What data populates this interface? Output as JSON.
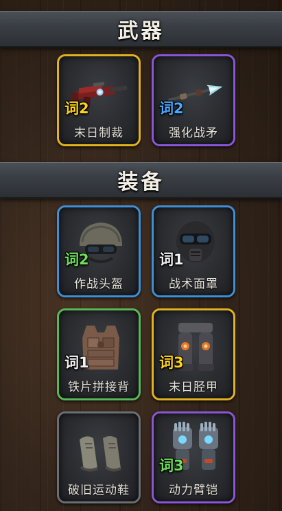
{
  "sections": [
    {
      "title": "武器"
    },
    {
      "title": "装备"
    }
  ],
  "colors": {
    "gold": "#e2b21f",
    "purple": "#8a56d8",
    "blue": "#3f8fd6",
    "green": "#58b857",
    "gray": "#6b6e72"
  },
  "weapons": [
    {
      "name": "末日制裁",
      "badge": "词2",
      "rarity": "gold",
      "icon": "plasma-rifle-icon"
    },
    {
      "name": "强化战矛",
      "badge": "词2",
      "rarity": "purple",
      "icon": "spear-icon"
    }
  ],
  "equipment": [
    {
      "name": "作战头盔",
      "badge": "词2",
      "rarity": "blue",
      "icon": "combat-helmet-icon"
    },
    {
      "name": "战术面罩",
      "badge": "词1",
      "rarity": "blue",
      "icon": "gas-mask-icon"
    },
    {
      "name": "铁片拼接背",
      "badge": "词1",
      "rarity": "green",
      "icon": "scrap-vest-icon"
    },
    {
      "name": "末日胫甲",
      "badge": "词3",
      "rarity": "gold",
      "icon": "leg-armor-icon"
    },
    {
      "name": "破旧运动鞋",
      "badge": "",
      "rarity": "gray",
      "icon": "worn-sneakers-icon"
    },
    {
      "name": "动力臂铠",
      "badge": "词3",
      "rarity": "purple",
      "icon": "power-gauntlets-icon"
    }
  ]
}
